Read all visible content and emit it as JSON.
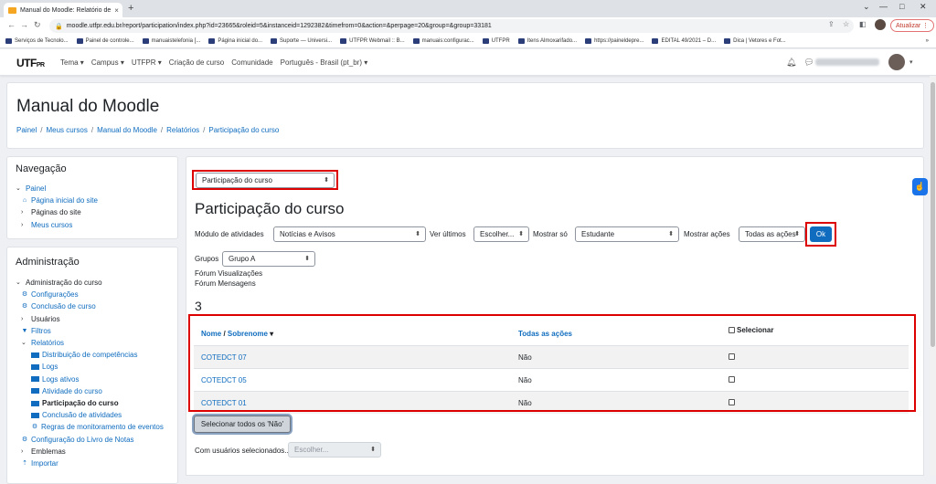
{
  "browser": {
    "tab_title": "Manual do Moodle: Relatório de",
    "url": "moodle.utfpr.edu.br/report/participation/index.php?id=23665&roleid=5&instanceid=1292382&timefrom=0&action=&perpage=20&group=&group=33181",
    "update_label": "Atualizar",
    "bookmarks": [
      "Serviços de Tecnolo...",
      "Painel de controle...",
      "manuaistelefonia [...",
      "Página inicial do...",
      "Suporte — Universi...",
      "UTFPR Webmail :: B...",
      "manuais:configurac...",
      "UTFPR",
      "Itens Almoxarifado...",
      "https://paineldepre...",
      "EDITAL 49/2021 – D...",
      "Dica | Vetores e Fot..."
    ]
  },
  "moodle_nav": {
    "logo": "UTF",
    "logo_suffix": "PR",
    "items": [
      "Tema ▾",
      "Campus ▾",
      "UTFPR ▾",
      "Criação de curso",
      "Comunidade",
      "Português - Brasil ‎(pt_br)‎ ▾"
    ]
  },
  "header": {
    "title": "Manual do Moodle",
    "breadcrumb": [
      "Painel",
      "Meus cursos",
      "Manual do Moodle",
      "Relatórios",
      "Participação do curso"
    ]
  },
  "navigation_block": {
    "title": "Navegação",
    "items": [
      "Painel",
      "Página inicial do site",
      "Páginas do site",
      "Meus cursos"
    ]
  },
  "admin_block": {
    "title": "Administração",
    "items": [
      "Administração do curso",
      "Configurações",
      "Conclusão de curso",
      "Usuários",
      "Filtros",
      "Relatórios",
      "Distribuição de competências",
      "Logs",
      "Logs ativos",
      "Atividade do curso",
      "Participação do curso",
      "Conclusão de atividades",
      "Regras de monitoramento de eventos",
      "Configuração do Livro de Notas",
      "Emblemas",
      "Importar"
    ]
  },
  "report": {
    "report_select": "Participação do curso",
    "heading": "Participação do curso",
    "module_label": "Módulo de atividades",
    "module_value": "Notícias e Avisos",
    "view_label": "Ver últimos",
    "view_value": "Escolher...",
    "show_label": "Mostrar só",
    "show_value": "Estudante",
    "actions_label": "Mostrar ações",
    "actions_value": "Todas as ações",
    "ok_label": "Ok",
    "groups_label": "Grupos",
    "groups_value": "Grupo A",
    "forum_views": "Fórum Visualizações",
    "forum_posts": "Fórum Mensagens",
    "count": "3",
    "col_name_a": "Nome",
    "col_name_sep": " / ",
    "col_name_b": "Sobrenome",
    "col_actions": "Todas as ações",
    "col_select": "Selecionar",
    "rows": [
      {
        "name": "COTEDCT 07",
        "actions": "Não"
      },
      {
        "name": "COTEDCT 05",
        "actions": "Não"
      },
      {
        "name": "COTEDCT 01",
        "actions": "Não"
      }
    ],
    "select_all_no": "Selecionar todos os 'Não'",
    "with_selected_label": "Com usuários selecionados...",
    "with_selected_value": "Escolher..."
  }
}
